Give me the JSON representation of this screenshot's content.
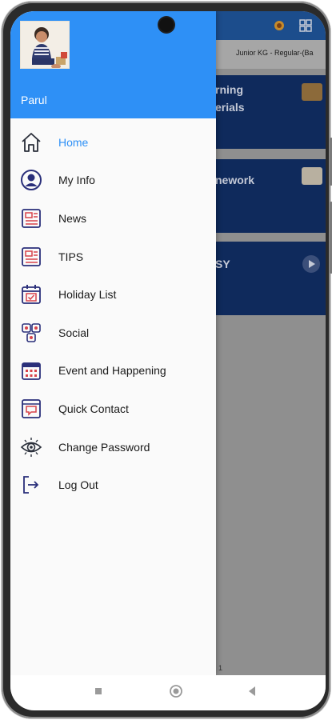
{
  "background_app": {
    "class_label": "Junior KG - Regular-(Ba",
    "cards": [
      {
        "line1": "rning",
        "line2": "erials"
      },
      {
        "line1": "nework",
        "line2": ""
      },
      {
        "line1": "SY",
        "line2": ""
      }
    ],
    "page_number": "1"
  },
  "drawer": {
    "user_name": "Parul",
    "menu": [
      {
        "label": "Home",
        "icon": "home-icon",
        "active": true
      },
      {
        "label": "My Info",
        "icon": "user-icon",
        "active": false
      },
      {
        "label": "News",
        "icon": "news-icon",
        "active": false
      },
      {
        "label": "TIPS",
        "icon": "tips-icon",
        "active": false
      },
      {
        "label": "Holiday List",
        "icon": "calendar-icon",
        "active": false
      },
      {
        "label": "Social",
        "icon": "social-icon",
        "active": false
      },
      {
        "label": "Event and Happening",
        "icon": "event-calendar-icon",
        "active": false
      },
      {
        "label": "Quick Contact",
        "icon": "contact-icon",
        "active": false
      },
      {
        "label": "Change Password",
        "icon": "eye-icon",
        "active": false
      },
      {
        "label": "Log Out",
        "icon": "logout-icon",
        "active": false
      }
    ]
  },
  "colors": {
    "header_blue": "#2e90f6",
    "active_text": "#2e90f6",
    "icon_navy": "#2a2f7a",
    "icon_red": "#d8434a"
  }
}
